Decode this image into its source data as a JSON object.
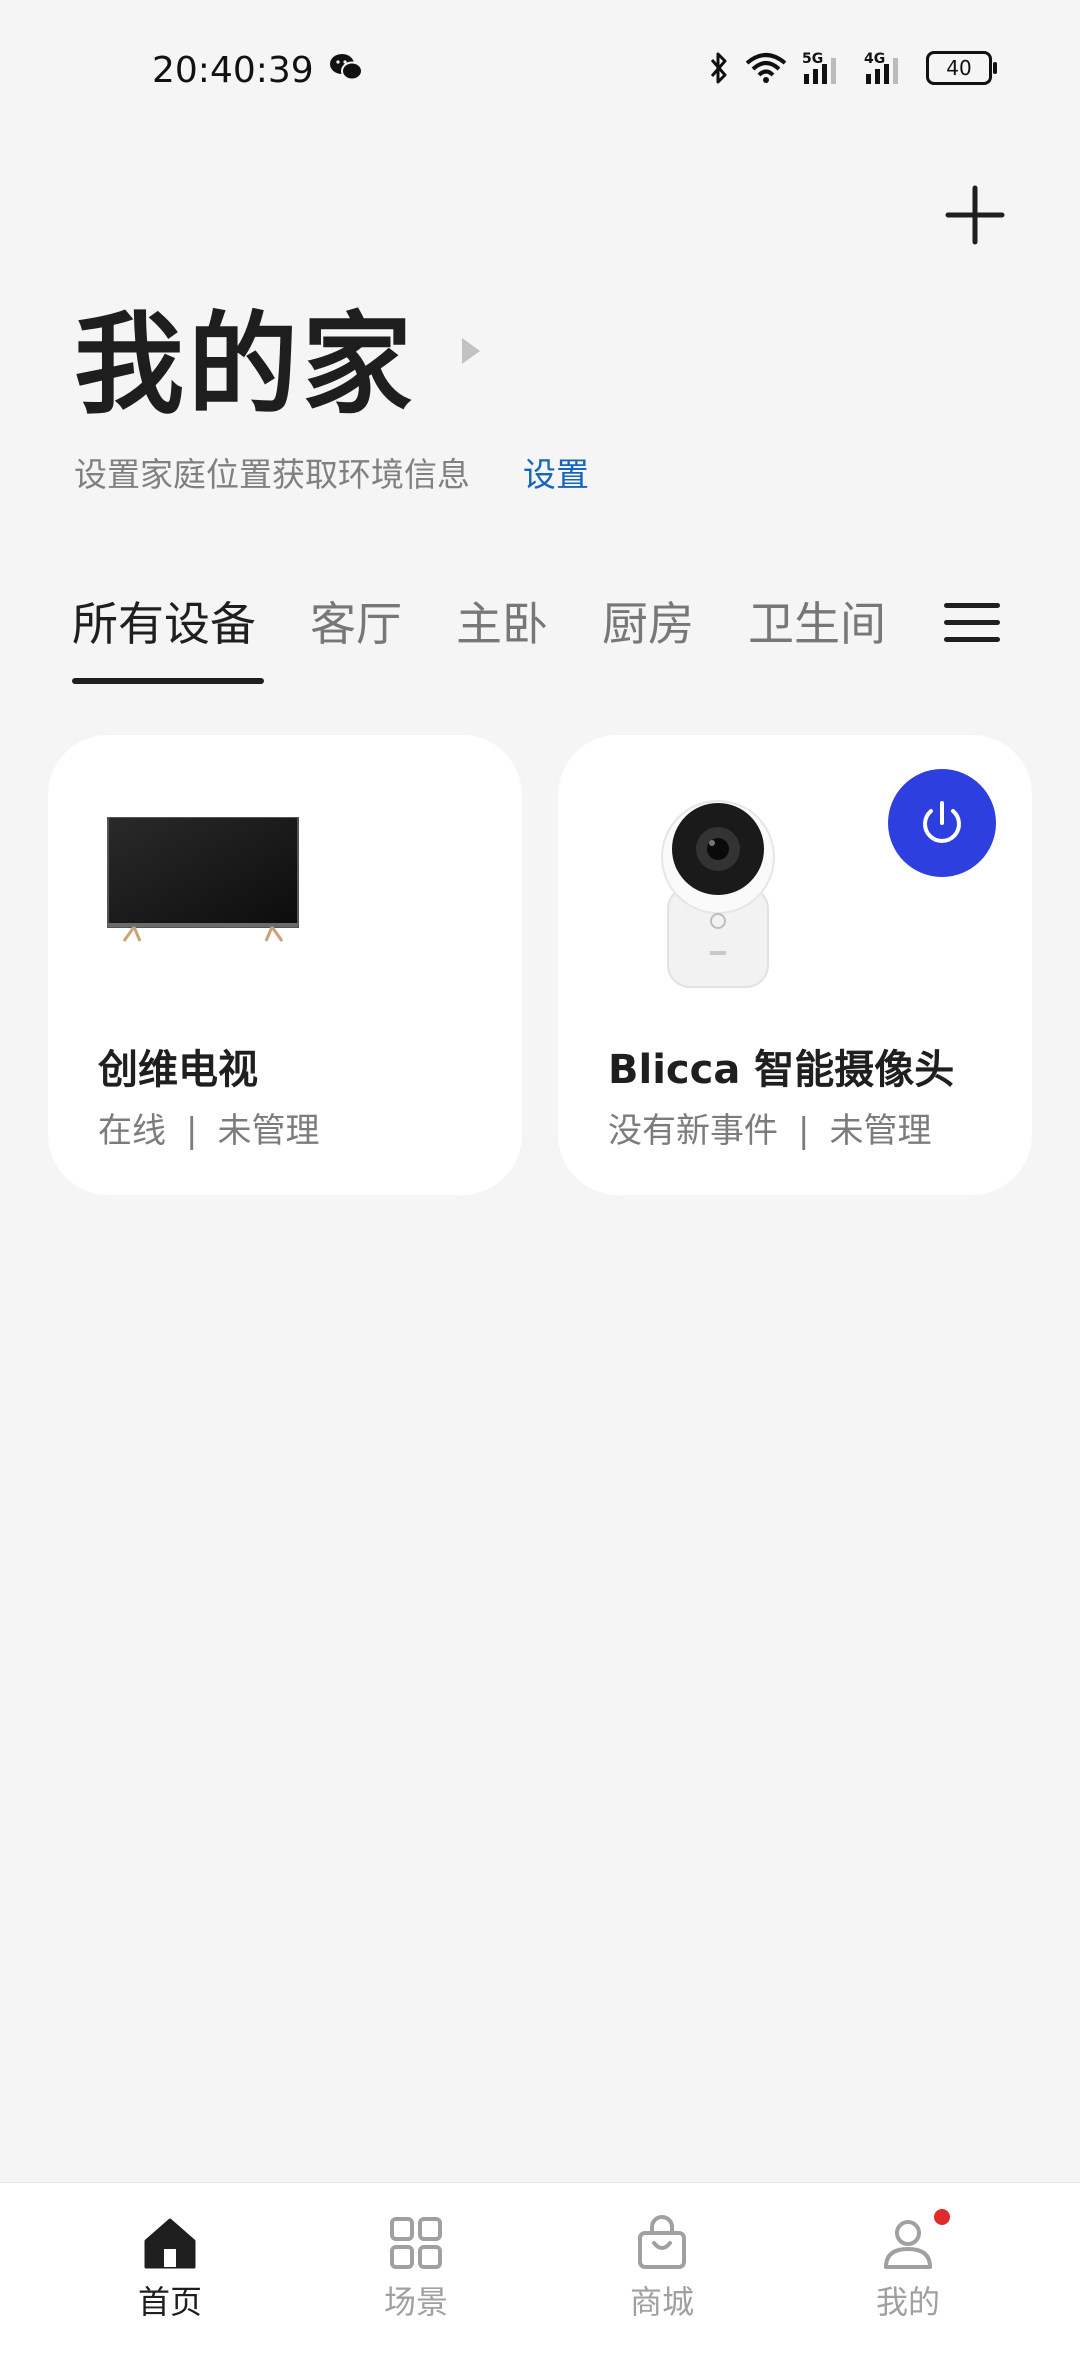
{
  "status_bar": {
    "time": "20:40:39",
    "battery": "40",
    "icons": [
      "wechat-icon",
      "bluetooth-icon",
      "wifi-icon",
      "signal-5g-icon",
      "signal-4g-icon",
      "battery-icon"
    ]
  },
  "header": {
    "title": "我的家",
    "location_hint": "设置家庭位置获取环境信息",
    "location_link": "设置"
  },
  "tabs": [
    {
      "label": "所有设备",
      "active": true
    },
    {
      "label": "客厅"
    },
    {
      "label": "主卧"
    },
    {
      "label": "厨房"
    },
    {
      "label": "卫生间"
    }
  ],
  "devices": [
    {
      "name": "创维电视",
      "status": "在线",
      "separator": "|",
      "management": "未管理"
    },
    {
      "name": "Blicca 智能摄像头",
      "status": "没有新事件",
      "separator": "|",
      "management": "未管理"
    }
  ],
  "bottom_nav": [
    {
      "label": "首页",
      "icon": "home-icon",
      "active": true
    },
    {
      "label": "场景",
      "icon": "grid-icon"
    },
    {
      "label": "商城",
      "icon": "shopping-bag-icon"
    },
    {
      "label": "我的",
      "icon": "person-icon",
      "badge": true
    }
  ],
  "colors": {
    "accent_link": "#1565c0",
    "power_button": "#2e3fe0",
    "badge": "#e02b2b",
    "background": "#f5f5f5"
  }
}
